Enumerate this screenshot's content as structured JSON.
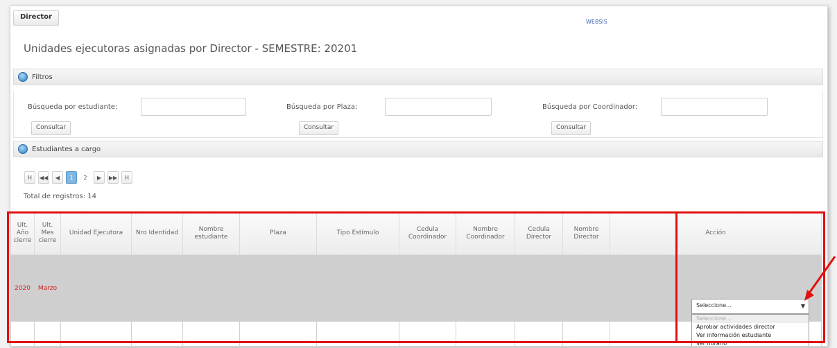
{
  "header": {
    "tab_label": "Director",
    "link_text": "WEBSIS"
  },
  "page_title": "Unidades ejecutoras asignadas por Director - SEMESTRE: 20201",
  "filters": {
    "section_label": "Filtros",
    "student_label": "Búsqueda por estudiante:",
    "plaza_label": "Búsqueda por Plaza:",
    "coordinator_label": "Búsqueda por Coordinador:",
    "consult_label": "Consultar"
  },
  "students": {
    "section_label": "Estudiantes a cargo",
    "pager": {
      "first": "H",
      "prev_page": "◀◀",
      "prev": "◀",
      "page1": "1",
      "page2": "2",
      "next": "▶",
      "next_page": "▶▶",
      "last": "H"
    },
    "total_label": "Total de registros: 14"
  },
  "table": {
    "columns": [
      "Ult. Año cierre",
      "Ult. Mes cierre",
      "Unidad Ejecutora",
      "Nro Identidad",
      "Nombre estudiante",
      "Plaza",
      "Tipo Estímulo",
      "Cedula Coordinador",
      "Nombre Coordinador",
      "Cedula Director",
      "Nombre Director",
      "Acción"
    ],
    "row1": {
      "year": "2020",
      "month": "Marzo"
    }
  },
  "action_select": {
    "selected": "Seleccione...",
    "options": [
      "Seleccione...",
      "Aprobar actividades director",
      "Ver información estudiante",
      "Ver horario"
    ]
  },
  "colors": {
    "highlight": "#e01010",
    "accent": "#2b7fc4"
  }
}
